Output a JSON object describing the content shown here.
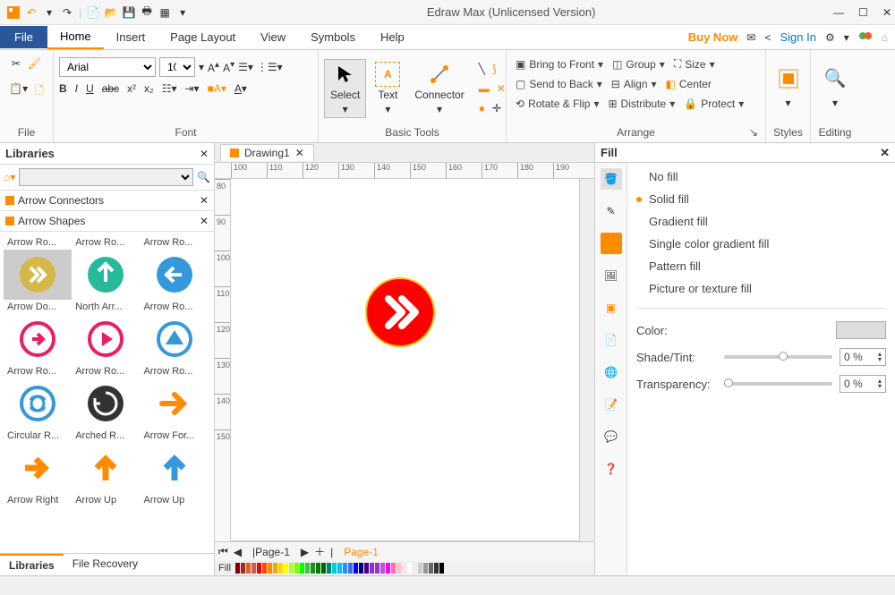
{
  "titlebar": {
    "title": "Edraw Max (Unlicensed Version)"
  },
  "menubar": {
    "file": "File",
    "tabs": [
      "Home",
      "Insert",
      "Page Layout",
      "View",
      "Symbols",
      "Help"
    ],
    "buy_now": "Buy Now",
    "sign_in": "Sign In"
  },
  "ribbon": {
    "file_label": "File",
    "font_label": "Font",
    "font_family": "Arial",
    "font_size": "10",
    "tools_label": "Basic Tools",
    "tool_select": "Select",
    "tool_text": "Text",
    "tool_connector": "Connector",
    "arrange_label": "Arrange",
    "bring_front": "Bring to Front",
    "send_back": "Send to Back",
    "rotate_flip": "Rotate & Flip",
    "group": "Group",
    "align": "Align",
    "distribute": "Distribute",
    "size": "Size",
    "center": "Center",
    "protect": "Protect",
    "styles_label": "Styles",
    "editing_label": "Editing"
  },
  "libraries": {
    "title": "Libraries",
    "sections": [
      "Arrow Connectors",
      "Arrow Shapes"
    ],
    "shape_labels_r1": [
      "Arrow Ro...",
      "Arrow Ro...",
      "Arrow Ro..."
    ],
    "shape_labels_r2": [
      "Arrow Do...",
      "North Arr...",
      "Arrow Ro..."
    ],
    "shape_labels_r3": [
      "Arrow Ro...",
      "Arrow Ro...",
      "Arrow Ro..."
    ],
    "shape_labels_r4": [
      "Circular R...",
      "Arched R...",
      "Arrow For..."
    ],
    "shape_labels_r5": [
      "Arrow Right",
      "Arrow Up",
      "Arrow Up"
    ],
    "bottom_tabs": [
      "Libraries",
      "File Recovery"
    ]
  },
  "doc": {
    "tab": "Drawing1",
    "ruler_h": [
      "100",
      "110",
      "120",
      "130",
      "140",
      "150",
      "160",
      "170",
      "180",
      "190"
    ],
    "ruler_v": [
      "80",
      "90",
      "100",
      "110",
      "120",
      "130",
      "140",
      "150"
    ],
    "page_tab1": "Page-1",
    "page_tab2": "Page-1",
    "fill_label": "Fill"
  },
  "fill": {
    "title": "Fill",
    "options": [
      "No fill",
      "Solid fill",
      "Gradient fill",
      "Single color gradient fill",
      "Pattern fill",
      "Picture or texture fill"
    ],
    "color_label": "Color:",
    "shade_label": "Shade/Tint:",
    "trans_label": "Transparency:",
    "shade_value": "0 %",
    "trans_value": "0 %"
  }
}
